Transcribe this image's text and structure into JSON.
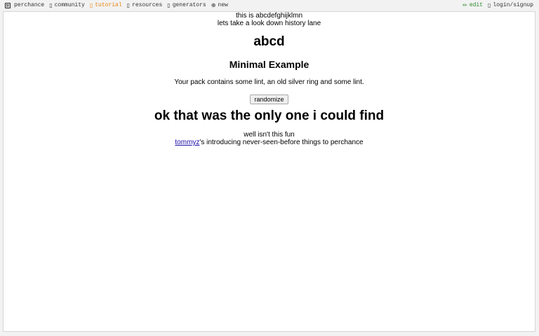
{
  "nav": {
    "brand": "perchance",
    "items": [
      {
        "label": "community",
        "icon": "community-icon",
        "glyph": "▯"
      },
      {
        "label": "tutorial",
        "icon": "tutorial-icon",
        "glyph": "▯"
      },
      {
        "label": "resources",
        "icon": "resources-icon",
        "glyph": "▯"
      },
      {
        "label": "generators",
        "icon": "generators-icon",
        "glyph": "▯"
      },
      {
        "label": "new",
        "icon": "new-icon",
        "glyph": "⊕"
      }
    ],
    "active_item": "tutorial",
    "edit_label": "edit",
    "edit_glyph": "✏",
    "login_label": "login/signup",
    "login_glyph": "▯"
  },
  "content": {
    "line1": "this is abcdefghijklmn",
    "line2": "lets take a look down history lane",
    "heading_abcd": "abcd",
    "heading_minimal": "Minimal Example",
    "pack_text": "Your pack contains some lint, an old silver ring and some lint.",
    "randomize_label": "randomize",
    "heading_only": "ok that was the only one i could find",
    "fun_text": "well isn't this fun",
    "user_link": "tommyz",
    "intro_text": "'s introducing never-seen-before things to perchance"
  },
  "colors": {
    "active": "#e8820c",
    "edit": "#2c8a2c",
    "link": "#1a0dab"
  }
}
